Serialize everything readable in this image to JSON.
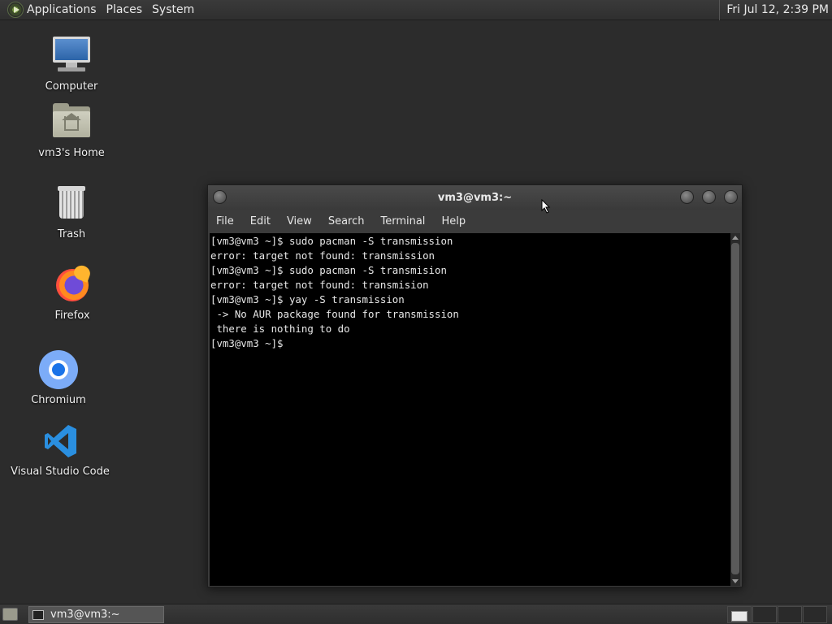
{
  "top_panel": {
    "menus": [
      "Applications",
      "Places",
      "System"
    ],
    "clock": "Fri Jul 12,  2:39 PM"
  },
  "desktop_icons": [
    {
      "label": "Computer",
      "icon": "computer-icon"
    },
    {
      "label": "vm3's Home",
      "icon": "home-folder-icon"
    },
    {
      "label": "Trash",
      "icon": "trash-icon"
    },
    {
      "label": "Firefox",
      "icon": "firefox-icon"
    },
    {
      "label": "Chromium",
      "icon": "chromium-icon"
    },
    {
      "label": "Visual Studio Code",
      "icon": "vscode-icon"
    }
  ],
  "terminal": {
    "title": "vm3@vm3:~",
    "menu": [
      "File",
      "Edit",
      "View",
      "Search",
      "Terminal",
      "Help"
    ],
    "lines": [
      "[vm3@vm3 ~]$ sudo pacman -S transmission",
      "error: target not found: transmission",
      "[vm3@vm3 ~]$ sudo pacman -S transmision",
      "error: target not found: transmision",
      "[vm3@vm3 ~]$ yay -S transmission",
      " -> No AUR package found for transmission",
      " there is nothing to do",
      "[vm3@vm3 ~]$ "
    ]
  },
  "bottom_panel": {
    "taskbar_item": "vm3@vm3:~"
  }
}
